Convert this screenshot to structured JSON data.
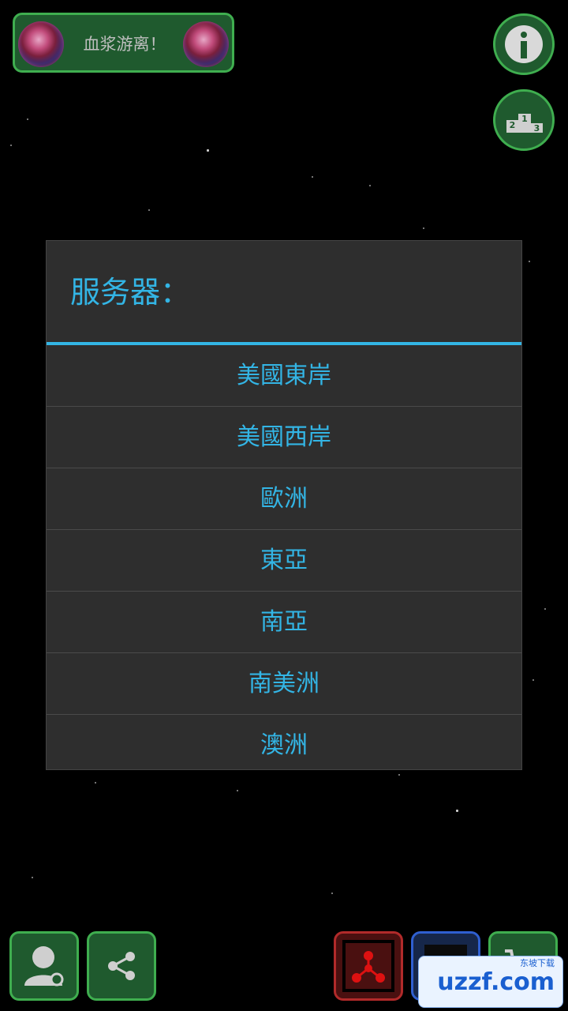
{
  "app": {
    "title": "血浆游离！"
  },
  "dialog": {
    "title": "服务器：",
    "options": [
      "美國東岸",
      "美國西岸",
      "歐洲",
      "東亞",
      "南亞",
      "南美洲",
      "澳洲"
    ]
  },
  "colors": {
    "accent": "#33b5e5",
    "button_green": "#1f5a2e",
    "button_green_border": "#3fae4f",
    "background": "#000000"
  },
  "icons": {
    "info": "info-icon",
    "leaderboard": "podium-icon",
    "profile": "user-settings-icon",
    "share": "share-icon",
    "radio": "radiation-icon",
    "gallery": "image-icon",
    "cart": "cart-icon"
  },
  "watermark": {
    "brand": "uzzf.com",
    "tagline": "东坡下载"
  }
}
